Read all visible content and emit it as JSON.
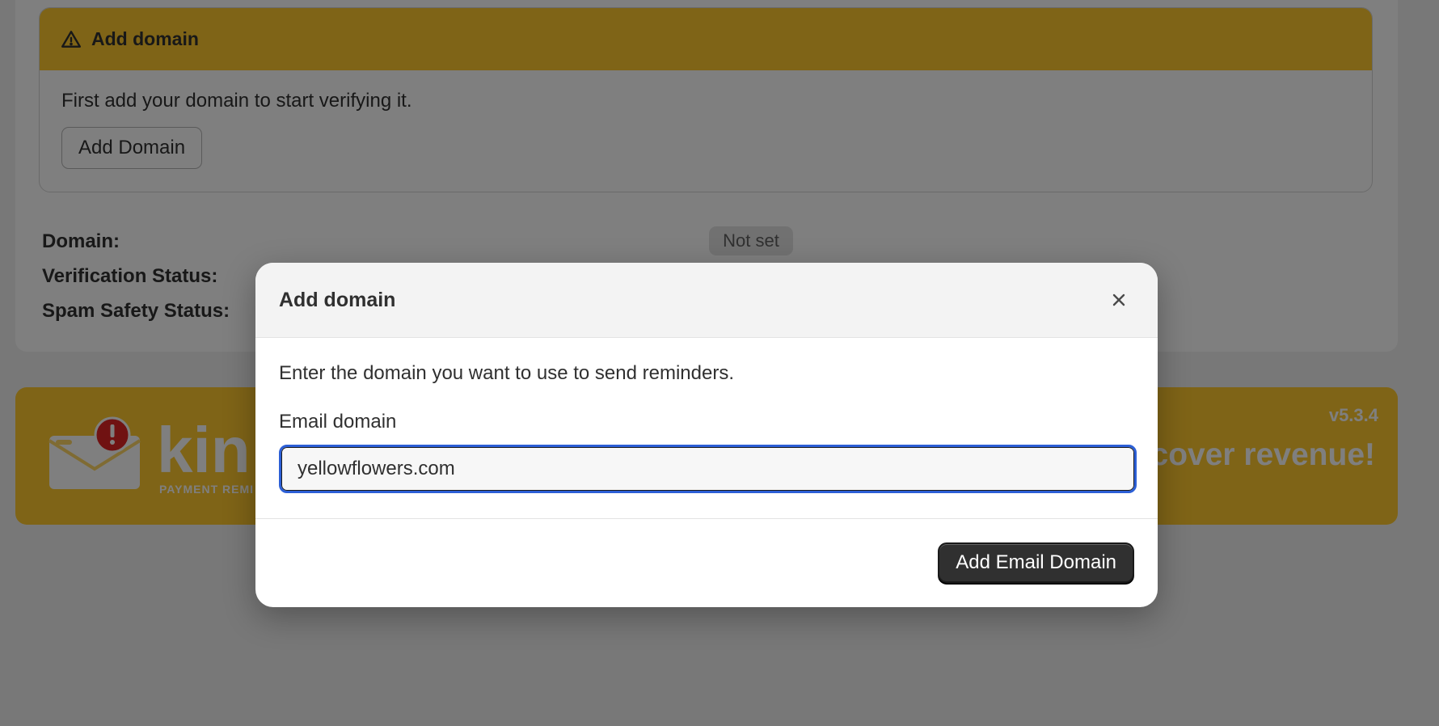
{
  "background": {
    "banner": {
      "title": "Add domain",
      "text": "First add your domain to start verifying it.",
      "button_label": "Add Domain"
    },
    "info": {
      "domain_label": "Domain:",
      "domain_value": "Not set",
      "verification_label": "Verification Status:",
      "spam_label": "Spam Safety Status:"
    },
    "promo": {
      "version": "v5.3.4",
      "tagline": "ecover revenue!",
      "brand": "kin",
      "subtitle": "PAYMENT REMI"
    }
  },
  "modal": {
    "title": "Add domain",
    "description": "Enter the domain you want to use to send reminders.",
    "field_label": "Email domain",
    "field_value": "yellowflowers.com",
    "submit_label": "Add Email Domain"
  },
  "colors": {
    "accent": "#ffc92e",
    "primary_button": "#303030",
    "focus_ring": "#2c5fd6"
  },
  "icons": {
    "banner": "warning-icon",
    "close": "close-icon",
    "promo_logo": "envelope-alert-icon"
  }
}
